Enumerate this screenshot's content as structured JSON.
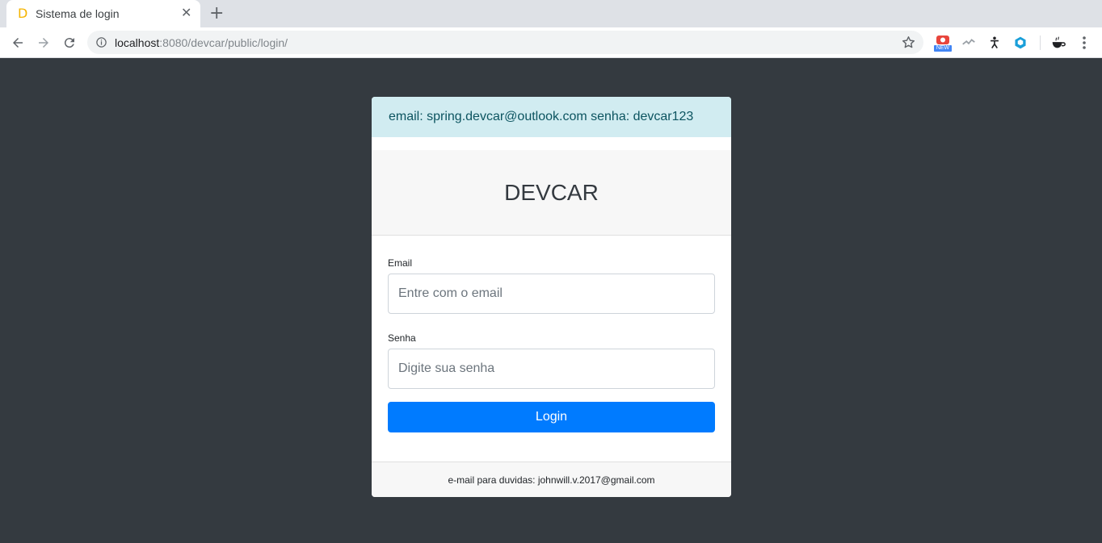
{
  "browser": {
    "tab": {
      "title": "Sistema de login",
      "favicon": "D"
    },
    "url": {
      "host": "localhost",
      "path": ":8080/devcar/public/login/"
    },
    "extensions": {
      "new_badge": "NEW"
    },
    "icons": [
      "back-icon",
      "forward-icon",
      "reload-icon",
      "info-icon",
      "star-icon",
      "menu-icon"
    ]
  },
  "alert": {
    "text": "email: spring.devcar@outlook.com senha: devcar123"
  },
  "card": {
    "brand": "DEVCAR",
    "email": {
      "label": "Email",
      "placeholder": "Entre com o email",
      "value": ""
    },
    "password": {
      "label": "Senha",
      "placeholder": "Digite sua senha",
      "value": ""
    },
    "login_button": "Login",
    "footer": "e-mail para duvidas: johnwill.v.2017@gmail.com"
  },
  "colors": {
    "background": "#343a40",
    "alert_bg": "#d1ecf1",
    "alert_text": "#0c5460",
    "primary": "#007bff"
  }
}
